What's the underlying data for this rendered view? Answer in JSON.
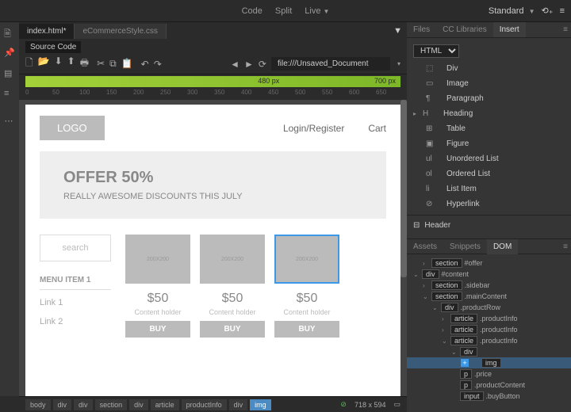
{
  "topbar": {
    "modes": [
      "Code",
      "Split",
      "Live"
    ],
    "active": "Live",
    "workspace": "Standard"
  },
  "tabs": {
    "active": "index.html*",
    "inactive": "eCommerceStyle.css",
    "source": "Source Code"
  },
  "url": "file:///Unsaved_Document",
  "greenbar": {
    "a": "480  px",
    "b": "700  px"
  },
  "ruler": [
    "0",
    "50",
    "100",
    "150",
    "200",
    "250",
    "300",
    "350",
    "400",
    "450",
    "500",
    "550",
    "600",
    "650"
  ],
  "page": {
    "logo": "LOGO",
    "login": "Login/Register",
    "cart": "Cart",
    "offer": {
      "title": "OFFER 50%",
      "sub": "REALLY AWESOME DISCOUNTS THIS JULY"
    },
    "search": "search",
    "menu": "MENU ITEM 1",
    "links": [
      "Link 1",
      "Link 2"
    ],
    "imgsize": "200X200",
    "products": [
      {
        "price": "$50",
        "ch": "Content holder",
        "buy": "BUY"
      },
      {
        "price": "$50",
        "ch": "Content holder",
        "buy": "BUY"
      },
      {
        "price": "$50",
        "ch": "Content holder",
        "buy": "BUY",
        "selected": true,
        "badge": "img"
      }
    ]
  },
  "breadcrumb": [
    "body",
    "div",
    "div",
    "section",
    "div",
    "article",
    "productInfo",
    "div",
    "img"
  ],
  "bc_active": "img",
  "dims": "718 x 594",
  "panels": {
    "tabs1": [
      "Files",
      "CC Libraries",
      "Insert"
    ],
    "tabs1_active": "Insert",
    "dropdown": "HTML",
    "items": [
      {
        "icon": "⬚",
        "label": "Div"
      },
      {
        "icon": "▭",
        "label": "Image"
      },
      {
        "icon": "¶",
        "label": "Paragraph"
      },
      {
        "icon": "H",
        "label": "Heading",
        "sub": true
      },
      {
        "icon": "⊞",
        "label": "Table"
      },
      {
        "icon": "▣",
        "label": "Figure"
      },
      {
        "icon": "ul",
        "label": "Unordered List"
      },
      {
        "icon": "ol",
        "label": "Ordered List"
      },
      {
        "icon": "li",
        "label": "List Item"
      },
      {
        "icon": "⊘",
        "label": "Hyperlink"
      }
    ],
    "header": {
      "icon": "⊟",
      "label": "Header"
    },
    "tabs2": [
      "Assets",
      "Snippets",
      "DOM"
    ],
    "tabs2_active": "DOM",
    "dom": [
      {
        "indent": 1,
        "caret": "›",
        "tag": "section",
        "cls": "#offer"
      },
      {
        "indent": 0,
        "caret": "⌄",
        "tag": "div",
        "cls": "#content"
      },
      {
        "indent": 1,
        "caret": "›",
        "tag": "section",
        "cls": ".sidebar"
      },
      {
        "indent": 1,
        "caret": "⌄",
        "tag": "section",
        "cls": ".mainContent"
      },
      {
        "indent": 2,
        "caret": "⌄",
        "tag": "div",
        "cls": ".productRow"
      },
      {
        "indent": 3,
        "caret": "›",
        "tag": "article",
        "cls": ".productInfo"
      },
      {
        "indent": 3,
        "caret": "›",
        "tag": "article",
        "cls": ".productInfo"
      },
      {
        "indent": 3,
        "caret": "⌄",
        "tag": "article",
        "cls": ".productInfo"
      },
      {
        "indent": 4,
        "caret": "⌄",
        "tag": "div",
        "cls": ""
      },
      {
        "indent": 5,
        "caret": "",
        "tag": "img",
        "cls": "",
        "hl": true,
        "plus": true
      },
      {
        "indent": 4,
        "caret": "",
        "tag": "p",
        "cls": ".price"
      },
      {
        "indent": 4,
        "caret": "",
        "tag": "p",
        "cls": ".productContent"
      },
      {
        "indent": 4,
        "caret": "",
        "tag": "input",
        "cls": ".buyButton"
      }
    ]
  }
}
